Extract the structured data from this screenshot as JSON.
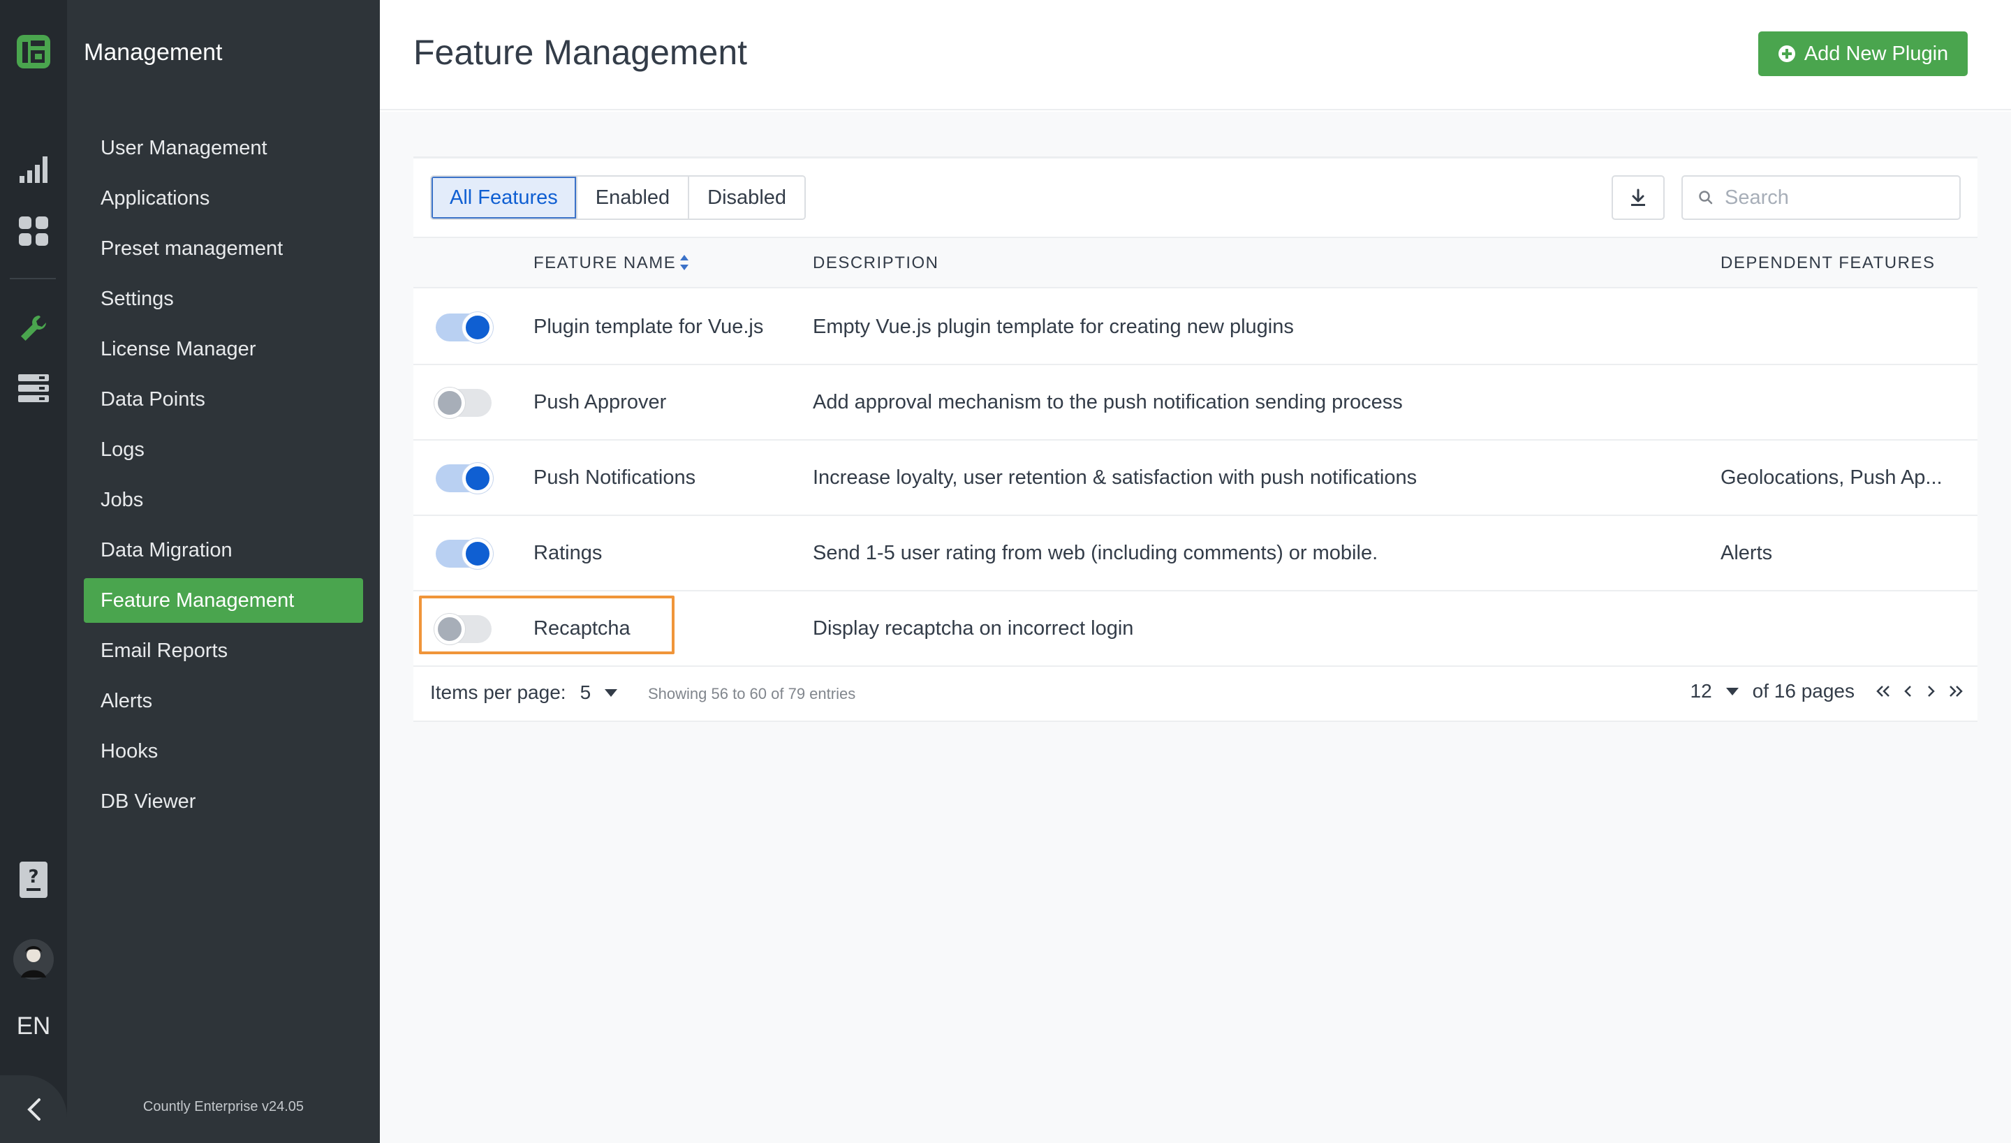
{
  "app": {
    "section_title": "Management",
    "version": "Countly Enterprise v24.05",
    "language": "EN"
  },
  "rail": {
    "icons": [
      "countly-logo-icon",
      "analytics-icon",
      "dashboard-icon",
      "management-wrench-icon",
      "data-manager-icon",
      "help-icon",
      "avatar",
      "collapse-chevron-icon"
    ]
  },
  "sidebar": {
    "items": [
      {
        "label": "User Management"
      },
      {
        "label": "Applications"
      },
      {
        "label": "Preset management"
      },
      {
        "label": "Settings"
      },
      {
        "label": "License Manager"
      },
      {
        "label": "Data Points"
      },
      {
        "label": "Logs"
      },
      {
        "label": "Jobs"
      },
      {
        "label": "Data Migration"
      },
      {
        "label": "Feature Management",
        "active": true
      },
      {
        "label": "Email Reports"
      },
      {
        "label": "Alerts"
      },
      {
        "label": "Hooks"
      },
      {
        "label": "DB Viewer"
      }
    ]
  },
  "header": {
    "title": "Feature Management",
    "add_button": "Add New Plugin"
  },
  "toolbar": {
    "tabs": [
      {
        "label": "All Features",
        "active": true
      },
      {
        "label": "Enabled"
      },
      {
        "label": "Disabled"
      }
    ],
    "search_placeholder": "Search"
  },
  "table": {
    "columns": {
      "name": "FEATURE NAME",
      "description": "DESCRIPTION",
      "dependent": "DEPENDENT FEATURES"
    },
    "rows": [
      {
        "enabled": true,
        "name": "Plugin template for Vue.js",
        "description": "Empty Vue.js plugin template for creating new plugins",
        "dependent": ""
      },
      {
        "enabled": false,
        "name": "Push Approver",
        "description": "Add approval mechanism to the push notification sending process",
        "dependent": ""
      },
      {
        "enabled": true,
        "name": "Push Notifications",
        "description": "Increase loyalty, user retention & satisfaction with push notifications",
        "dependent": "Geolocations, Push Ap..."
      },
      {
        "enabled": true,
        "name": "Ratings",
        "description": "Send 1-5 user rating from web (including comments) or mobile.",
        "dependent": "Alerts"
      },
      {
        "enabled": false,
        "name": "Recaptcha",
        "description": "Display recaptcha on incorrect login",
        "dependent": "",
        "highlighted": true
      }
    ]
  },
  "footer": {
    "items_per_page_label": "Items per page:",
    "items_per_page": "5",
    "showing": "Showing 56 to 60 of 79 entries",
    "current_page": "12",
    "total_pages": "of 16 pages"
  },
  "colors": {
    "accent_green": "#4aa54e",
    "toggle_blue": "#0f5fd2",
    "highlight_orange": "#f0953a",
    "sidebar_dark": "#2e3439"
  }
}
